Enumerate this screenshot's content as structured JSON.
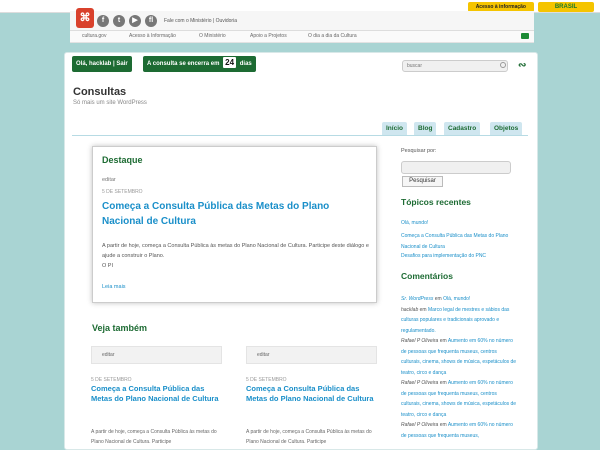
{
  "gov": {
    "acesso_label": "Acesso à informação",
    "brasil_label": "BRASIL"
  },
  "toolbar": {
    "top_links": "Fale com o Ministério | Ouvidoria",
    "nav": [
      "cultura.gov",
      "Acesso à Informação",
      "O Ministério",
      "Apoio a Projetos",
      "O dia a dia da Cultura"
    ],
    "social_icons": [
      "facebook-icon",
      "twitter-icon",
      "youtube-icon",
      "flickr-icon"
    ]
  },
  "user": {
    "greeting": "Olá, hacklab | Sair"
  },
  "countdown": {
    "prefix": "A consulta se encerra em",
    "days": "24",
    "suffix": "dias"
  },
  "search": {
    "placeholder": "buscar"
  },
  "site": {
    "title": "Consultas",
    "description": "Só mais um site WordPress"
  },
  "tabs": [
    "Início",
    "Blog",
    "Cadastro",
    "Objetos"
  ],
  "destaque": {
    "heading": "Destaque",
    "edit": "editar",
    "date": "5 DE SETEMBRO",
    "title": "Começa a Consulta Pública das Metas do Plano Nacional de Cultura",
    "body": "A partir de hoje, começa a Consulta Pública às metas do Plano Nacional de Cultura. Participe deste diálogo e ajude a construir o Plano.",
    "signature": "O PI",
    "more": "Leia mais"
  },
  "veja": {
    "heading": "Veja também",
    "items": [
      {
        "edit": "editar",
        "date": "5 DE SETEMBRO",
        "title": "Começa a Consulta Pública das Metas do Plano Nacional de Cultura",
        "body": "A partir de hoje, começa a Consulta Pública às metas do Plano Nacional de Cultura. Participe"
      },
      {
        "edit": "editar",
        "date": "5 DE SETEMBRO",
        "title": "Começa a Consulta Pública das Metas do Plano Nacional de Cultura",
        "body": "A partir de hoje, começa a Consulta Pública às metas do Plano Nacional de Cultura. Participe"
      }
    ]
  },
  "sidebar": {
    "search_label": "Pesquisar por:",
    "search_button": "Pesquisar",
    "recent_heading": "Tópicos recentes",
    "recent": [
      "Olá, mundo!",
      "Começa a Consulta Pública das Metas do Plano Nacional de Cultura",
      "Desafios para implementação do PNC"
    ],
    "comments_heading": "Comentários",
    "comments": [
      {
        "author": "Sr. WordPress",
        "on": "em",
        "post": "Olá, mundo!"
      },
      {
        "author": "hacklab",
        "on": "em",
        "post": "Marco legal de mestres e sábios das culturas populares e tradicionais aprovado e regulamentado."
      },
      {
        "author": "Rafael P Oliveira",
        "on": "em",
        "post": "Aumento em 60% no número de pessoas que frequenta museus, centros culturais, cinema, shows de música, espetáculos de teatro, circo e dança"
      },
      {
        "author": "Rafael P Oliveira",
        "on": "em",
        "post": "Aumento em 60% no número de pessoas que frequenta museus, centros culturais, cinema, shows de música, espetáculos de teatro, circo e dança"
      },
      {
        "author": "Rafael P Oliveira",
        "on": "em",
        "post": "Aumento em 60% no número de pessoas que frequenta museus,"
      }
    ]
  }
}
